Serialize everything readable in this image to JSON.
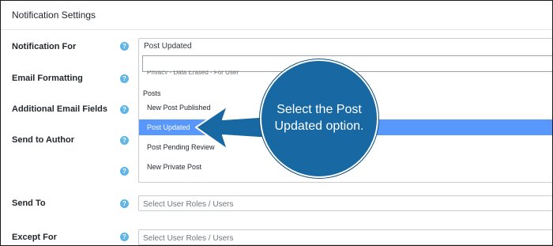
{
  "header": {
    "title": "Notification Settings"
  },
  "rows": {
    "notification_for": {
      "label": "Notification For",
      "value": "Post Updated"
    },
    "email_formatting": {
      "label": "Email Formatting"
    },
    "additional_email_fields": {
      "label": "Additional Email Fields"
    },
    "send_to_author": {
      "label": "Send to Author"
    },
    "send_to": {
      "label": "Send To",
      "placeholder": "Select User Roles / Users"
    },
    "except_for": {
      "label": "Except For",
      "placeholder": "Select User Roles / Users"
    }
  },
  "help_icon": "?",
  "dropdown": {
    "search_value": "",
    "clipped_option": "Privacy - Data Erased - For User",
    "group_label": "Posts",
    "options": [
      {
        "label": "New Post Published",
        "selected": false
      },
      {
        "label": "Post Updated",
        "selected": true
      },
      {
        "label": "Post Pending Review",
        "selected": false
      },
      {
        "label": "New Private Post",
        "selected": false
      }
    ]
  },
  "callout": {
    "line1": "Select the Post",
    "line2": "Updated option.",
    "color": "#1768a3"
  },
  "colors": {
    "selected_option": "#5897fb",
    "help_icon": "#5fb5e6"
  }
}
